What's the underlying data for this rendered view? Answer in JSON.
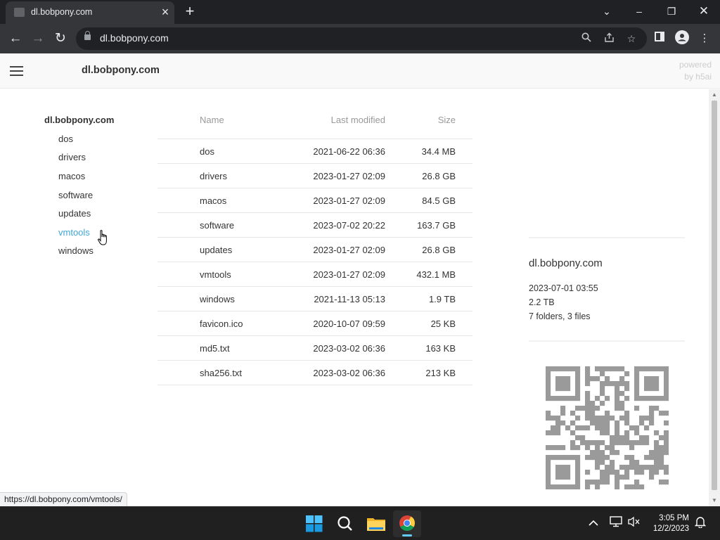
{
  "browser": {
    "tab_title": "dl.bobpony.com",
    "url": "dl.bobpony.com",
    "status_url": "https://dl.bobpony.com/vmtools/"
  },
  "header": {
    "title": "dl.bobpony.com",
    "powered_line1": "powered",
    "powered_line2": "by h5ai"
  },
  "sidebar": {
    "root": "dl.bobpony.com",
    "items": [
      "dos",
      "drivers",
      "macos",
      "software",
      "updates",
      "vmtools",
      "windows"
    ],
    "hovered": "vmtools"
  },
  "filelist": {
    "headers": {
      "name": "Name",
      "modified": "Last modified",
      "size": "Size"
    },
    "rows": [
      {
        "name": "dos",
        "modified": "2021-06-22 06:36",
        "size": "34.4 MB"
      },
      {
        "name": "drivers",
        "modified": "2023-01-27 02:09",
        "size": "26.8 GB"
      },
      {
        "name": "macos",
        "modified": "2023-01-27 02:09",
        "size": "84.5 GB"
      },
      {
        "name": "software",
        "modified": "2023-07-02 20:22",
        "size": "163.7 GB"
      },
      {
        "name": "updates",
        "modified": "2023-01-27 02:09",
        "size": "26.8 GB"
      },
      {
        "name": "vmtools",
        "modified": "2023-01-27 02:09",
        "size": "432.1 MB"
      },
      {
        "name": "windows",
        "modified": "2021-11-13 05:13",
        "size": "1.9 TB"
      },
      {
        "name": "favicon.ico",
        "modified": "2020-10-07 09:59",
        "size": "25 KB"
      },
      {
        "name": "md5.txt",
        "modified": "2023-03-02 06:36",
        "size": "163 KB"
      },
      {
        "name": "sha256.txt",
        "modified": "2023-03-02 06:36",
        "size": "213 KB"
      }
    ]
  },
  "info": {
    "name": "dl.bobpony.com",
    "modified": "2023-07-01 03:55",
    "size": "2.2 TB",
    "summary": "7 folders, 3 files"
  },
  "taskbar": {
    "time": "3:05 PM",
    "date": "12/2/2023"
  },
  "colors": {
    "link_hover": "#3ea6d6",
    "qr": "#9a9a9a",
    "taskbar_accent": "#60cdff"
  }
}
